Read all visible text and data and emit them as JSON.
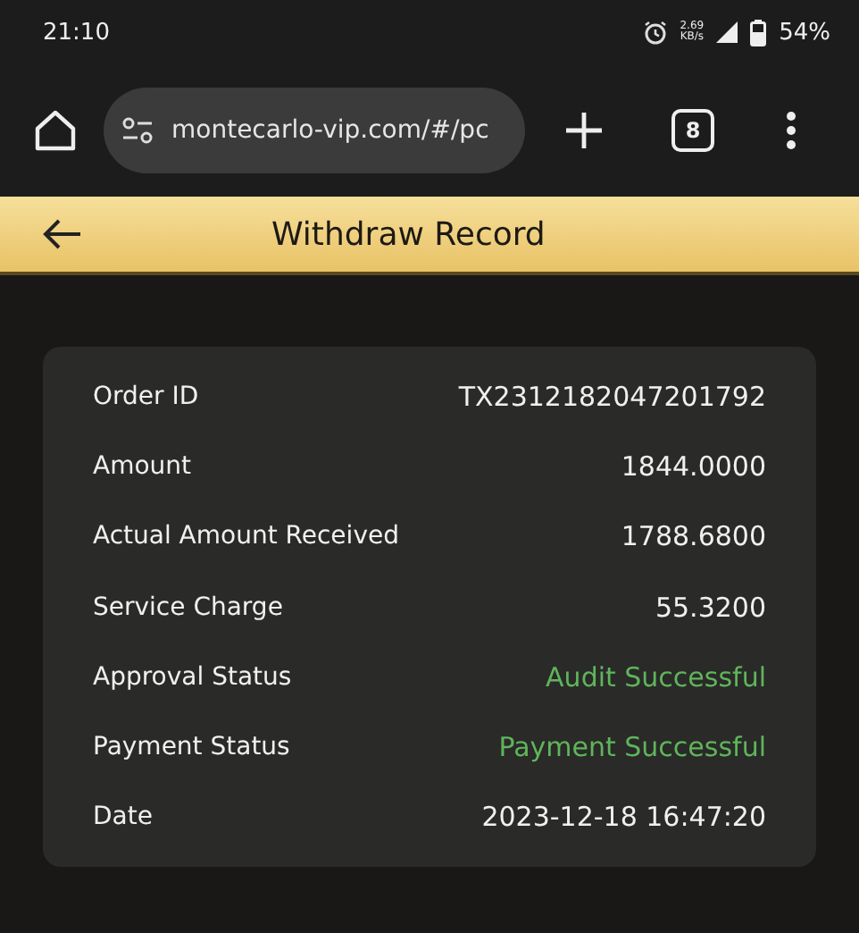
{
  "status_bar": {
    "time": "21:10",
    "net_speed": "2.69",
    "net_unit": "KB/s",
    "battery": "54%"
  },
  "browser": {
    "url": "montecarlo-vip.com/#/pc",
    "tab_count": "8"
  },
  "header": {
    "title": "Withdraw Record"
  },
  "record": [
    {
      "label": "Order ID",
      "value": "TX2312182047201792",
      "kind": "plain"
    },
    {
      "label": "Amount",
      "value": "1844.0000",
      "kind": "plain"
    },
    {
      "label": "Actual Amount Received",
      "value": "1788.6800",
      "kind": "plain"
    },
    {
      "label": "Service Charge",
      "value": "55.3200",
      "kind": "plain"
    },
    {
      "label": "Approval Status",
      "value": "Audit Successful",
      "kind": "success"
    },
    {
      "label": "Payment Status",
      "value": "Payment Successful",
      "kind": "success"
    },
    {
      "label": "Date",
      "value": "2023-12-18 16:47:20",
      "kind": "plain"
    }
  ]
}
